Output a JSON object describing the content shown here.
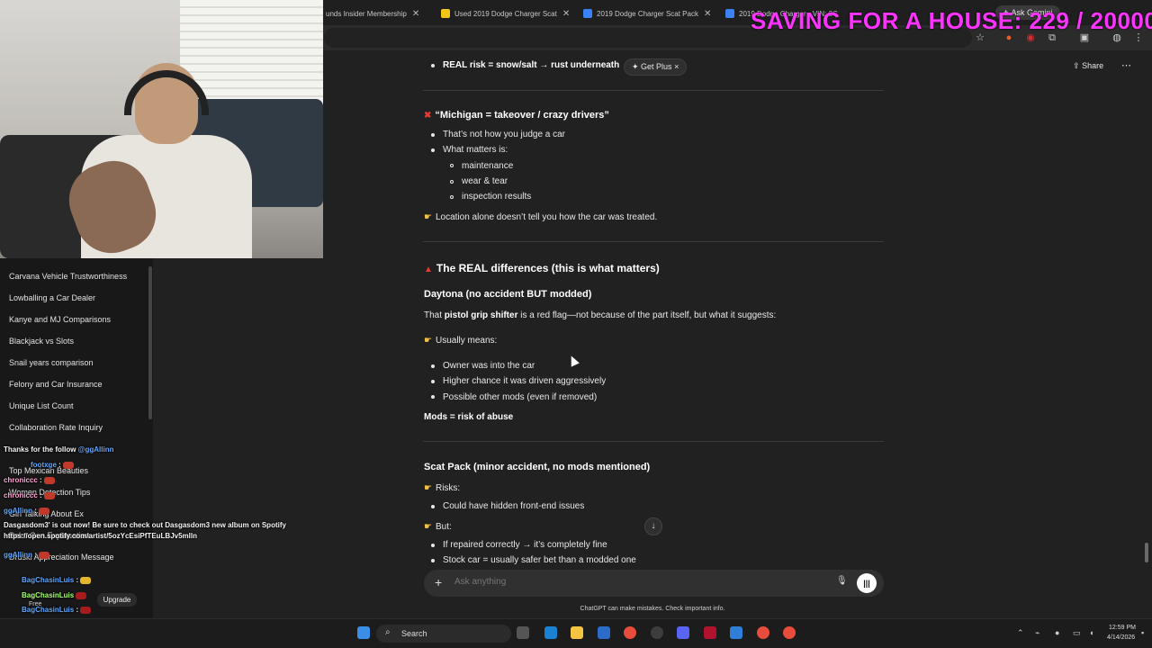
{
  "browser": {
    "tabs": [
      {
        "label": "unds Insider Membership",
        "icon_color": "#6b6b6b"
      },
      {
        "label": "Used 2019 Dodge Charger Scat",
        "icon_color": "#f5c518"
      },
      {
        "label": "2019 Dodge Charger Scat Pack",
        "icon_color": "#3b82f6"
      },
      {
        "label": "2019 Dodge Charger - VIN: 2C",
        "icon_color": "#3b82f6"
      }
    ],
    "ask_gemini": "Ask Gemini",
    "overlay_counter": "SAVING FOR A HOUSE: 229 / 20000"
  },
  "header": {
    "get_plus": "Get Plus",
    "share": "Share"
  },
  "sidebar": {
    "items": [
      "Carvana Vehicle Trustworthiness",
      "Lowballing a Car Dealer",
      "Kanye and MJ Comparisons",
      "Blackjack vs Slots",
      "Snail years comparison",
      "Felony and Car Insurance",
      "Unique List Count",
      "Collaboration Rate Inquiry",
      "Top Mexican Beauties",
      "Women Detection Tips",
      "Girl Talking About Ex",
      "Palm Gun Explanation",
      "Druski Appreciation Message"
    ],
    "upgrade": "Upgrade",
    "free": "Free"
  },
  "chat_overlay": [
    {
      "user": "",
      "msg": "Thanks for the follow ",
      "mention": "@ggAllinn"
    },
    {
      "user": "footxge",
      "msg": ""
    },
    {
      "user": "chroniccc",
      "msg": ""
    },
    {
      "user": "chroniccc",
      "msg": ""
    },
    {
      "user": "ggAllinn",
      "msg": ""
    },
    {
      "user": "",
      "msg": "Dasgasdom3' is out now! Be sure to check out Dasgasdom3 new album on Spotify https://open.spotify.com/artist/5ozYcEsiPfTEuLBJv5mlln"
    },
    {
      "user": "ggAllinn",
      "msg": ""
    },
    {
      "user": "BagChasinLuis",
      "msg": ""
    },
    {
      "user": "BagChasinLuis",
      "msg": ""
    },
    {
      "user": "BagChasinLuis",
      "msg": ""
    },
    {
      "user": "BagChasinLuis",
      "msg": ""
    },
    {
      "user": "BagChasinLuis",
      "msg": ""
    }
  ],
  "content": {
    "top_bullet": "REAL risk = snow/salt → rust underneath",
    "michigan_heading": "“Michigan = takeover / crazy drivers”",
    "michigan_bullets": [
      "That’s not how you judge a car",
      "What matters is:"
    ],
    "michigan_subbullets": [
      "maintenance",
      "wear & tear",
      "inspection results"
    ],
    "location_note": "Location alone doesn’t tell you how the car was treated.",
    "real_diff_heading": "The REAL differences (this is what matters)",
    "daytona_heading": "Daytona (no accident BUT modded)",
    "pistol_prefix": "That ",
    "pistol_bold": "pistol grip shifter",
    "pistol_suffix": " is a red flag—not because of the part itself, but what it suggests:",
    "usually_means": "Usually means:",
    "usually_bullets": [
      "Owner was into the car",
      "Higher chance it was driven aggressively",
      "Possible other mods (even if removed)"
    ],
    "mods_risk": "Mods = risk of abuse",
    "scat_heading": "Scat Pack (minor accident, no mods mentioned)",
    "risks_label": "Risks:",
    "risks_bullets": [
      "Could have hidden front-end issues"
    ],
    "but_label": "But:",
    "but_bullets": [
      "If repaired correctly → it’s completely fine",
      "Stock car = usually safer bet than a modded one"
    ]
  },
  "composer": {
    "placeholder": "Ask anything",
    "disclaimer": "ChatGPT can make mistakes. Check important info."
  },
  "taskbar": {
    "search": "Search",
    "time": "12:59 PM",
    "date": "4/14/2026"
  }
}
